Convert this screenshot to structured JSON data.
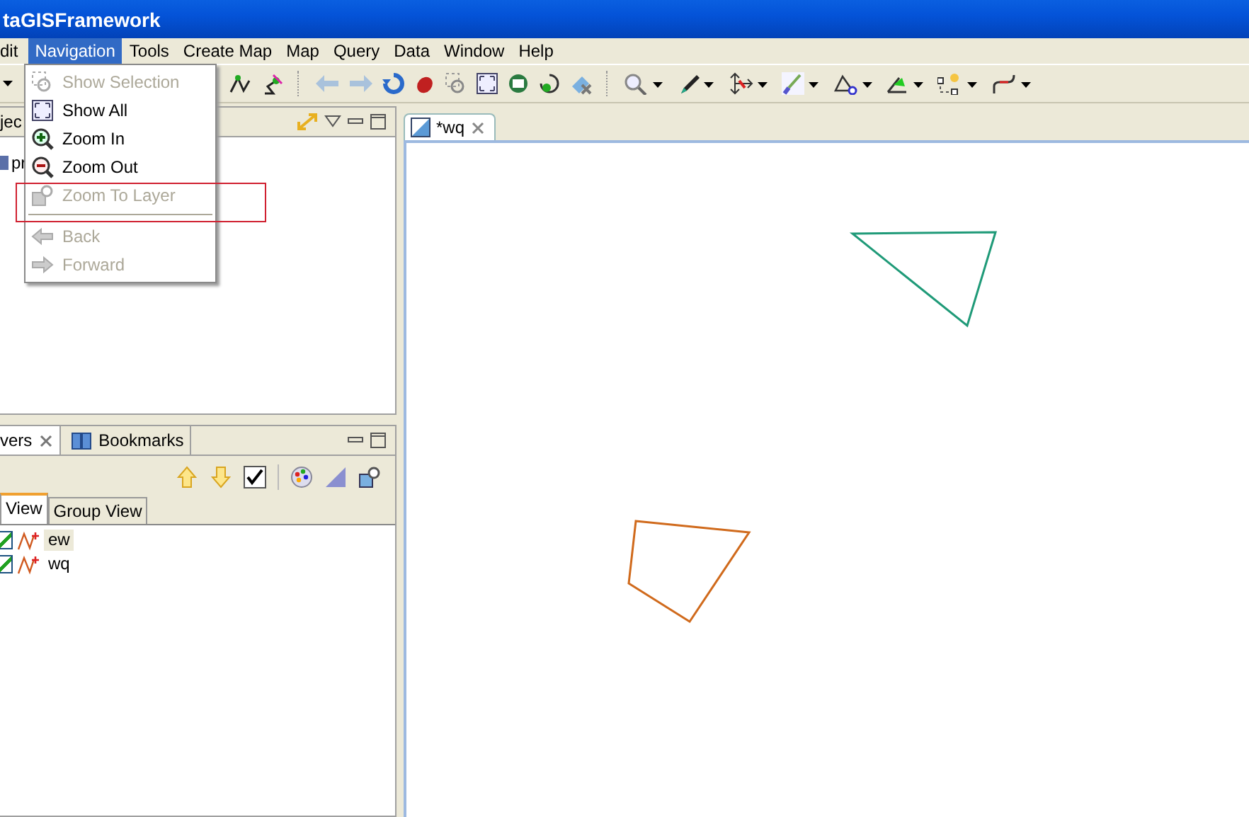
{
  "window": {
    "title": "taGISFramework"
  },
  "menubar": [
    {
      "label": "dit",
      "selected": false
    },
    {
      "label": "Navigation",
      "selected": true
    },
    {
      "label": "Tools",
      "selected": false
    },
    {
      "label": "Create Map",
      "selected": false
    },
    {
      "label": "Map",
      "selected": false
    },
    {
      "label": "Query",
      "selected": false
    },
    {
      "label": "Data",
      "selected": false
    },
    {
      "label": "Window",
      "selected": false
    },
    {
      "label": "Help",
      "selected": false
    }
  ],
  "navigation_menu": [
    {
      "kind": "item",
      "label": "Show Selection",
      "disabled": true,
      "highlighted": false
    },
    {
      "kind": "item",
      "label": "Show All",
      "disabled": false,
      "highlighted": false
    },
    {
      "kind": "item",
      "label": "Zoom In",
      "disabled": false,
      "highlighted": false
    },
    {
      "kind": "item",
      "label": "Zoom Out",
      "disabled": false,
      "highlighted": false
    },
    {
      "kind": "item",
      "label": "Zoom To Layer",
      "disabled": true,
      "highlighted": true
    },
    {
      "kind": "separator"
    },
    {
      "kind": "item",
      "label": "Back",
      "disabled": true,
      "highlighted": false
    },
    {
      "kind": "item",
      "label": "Forward",
      "disabled": true,
      "highlighted": false
    }
  ],
  "project_panel": {
    "tab": "jec",
    "tree_item": "pr"
  },
  "layers_panel": {
    "tabs": [
      {
        "label": "vers",
        "selected": true,
        "closable": true
      },
      {
        "label": "Bookmarks",
        "selected": false,
        "closable": false
      }
    ],
    "view_tabs": [
      {
        "label": "View",
        "selected": true
      },
      {
        "label": "Group View",
        "selected": false
      }
    ],
    "layers": [
      {
        "name": "ew",
        "checked": true,
        "selected": true
      },
      {
        "name": "wq",
        "checked": true,
        "selected": false
      }
    ]
  },
  "editor": {
    "tab": "*wq"
  }
}
